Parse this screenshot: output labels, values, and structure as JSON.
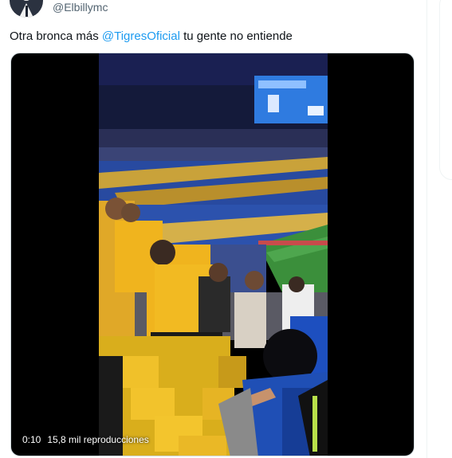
{
  "tweet": {
    "handle": "@Elbillymc",
    "text_before": "Otra bronca más ",
    "mention": "@TigresOficial",
    "text_after": " tu gente no entiende"
  },
  "video": {
    "time": "0:10",
    "views": "15,8 mil reproducciones"
  },
  "colors": {
    "link": "#1d9bf0",
    "secondary_text": "#536471",
    "jersey_yellow": "#f0b41e",
    "fan_blue": "#1f4fb5"
  }
}
